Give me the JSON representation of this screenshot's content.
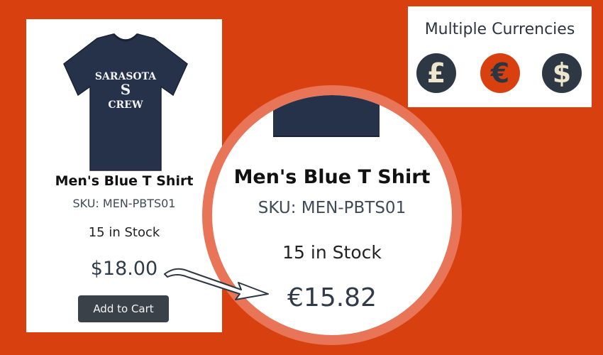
{
  "product": {
    "name": "Men's Blue T Shirt",
    "sku": "SKU: MEN-PBTS01",
    "stock": "15 in Stock",
    "price": "$18.00",
    "add_to_cart_label": "Add to Cart",
    "shirt_print": [
      "SARASOTA",
      "S",
      "CREW"
    ],
    "shirt_color": "#26324a"
  },
  "zoom": {
    "name": "Men's Blue T Shirt",
    "sku": "SKU: MEN-PBTS01",
    "stock": "15 in Stock",
    "price": "€15.82"
  },
  "currencies": {
    "title": "Multiple Currencies",
    "items": [
      {
        "symbol": "£",
        "icon": "pound-icon"
      },
      {
        "symbol": "€",
        "icon": "euro-icon"
      },
      {
        "symbol": "$",
        "icon": "dollar-icon"
      }
    ]
  },
  "colors": {
    "background": "#d9400f",
    "dark": "#2e3844",
    "ring": "#e87558"
  }
}
